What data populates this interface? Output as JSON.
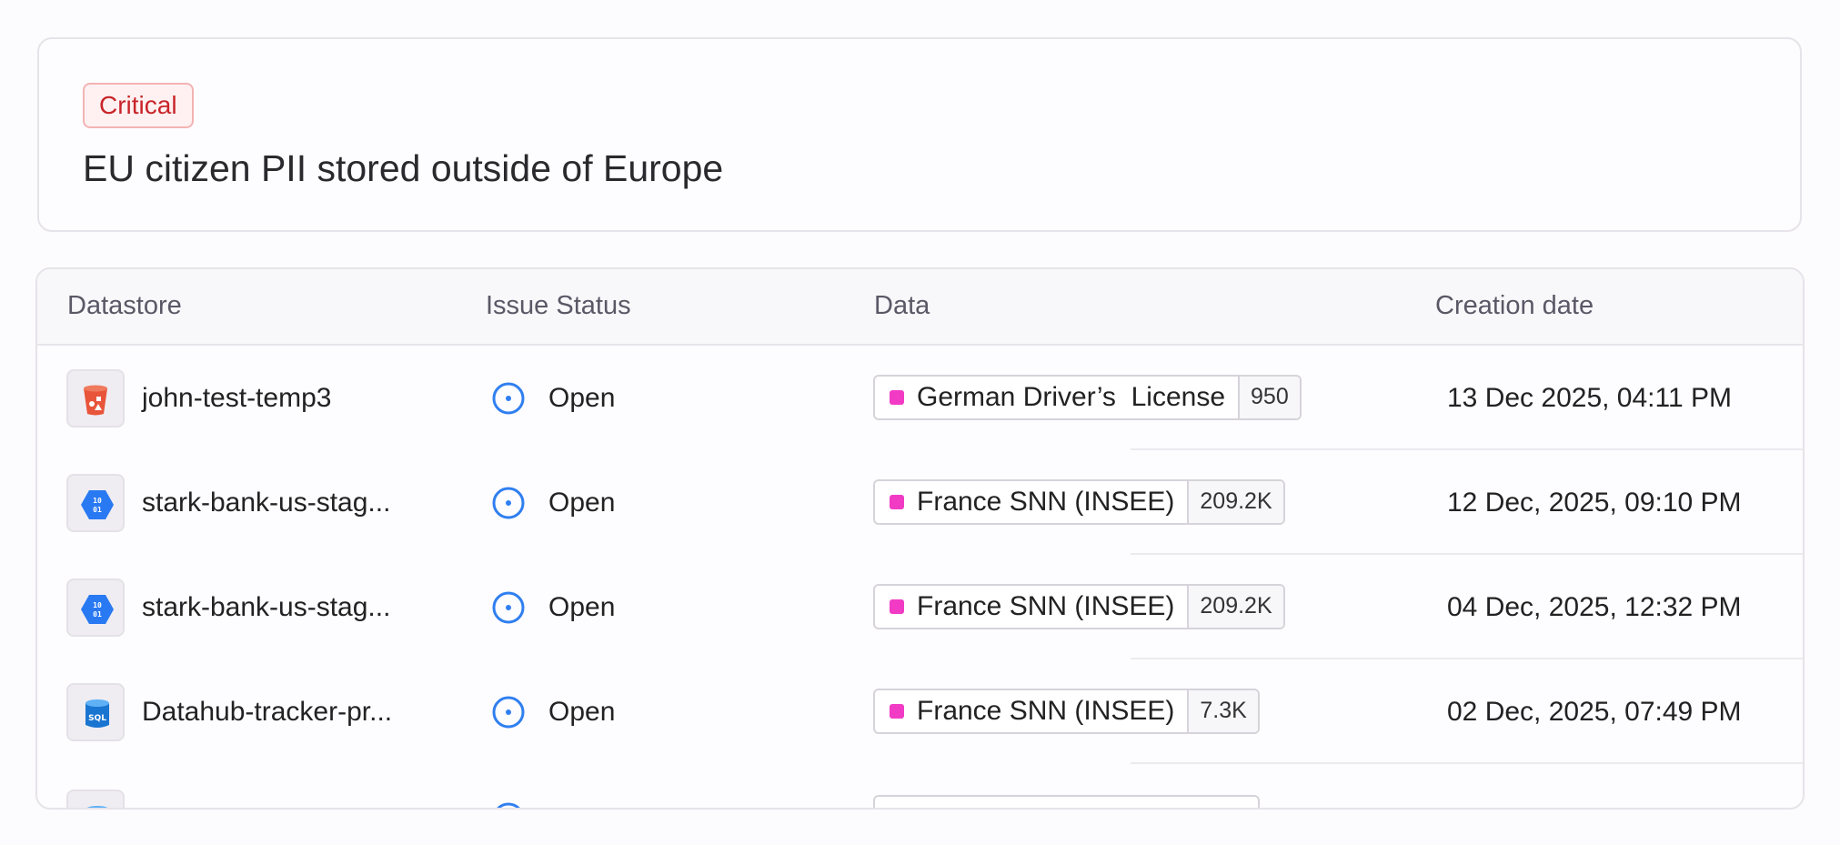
{
  "issue": {
    "severity": "Critical",
    "title": "EU citizen PII stored outside of Europe"
  },
  "table": {
    "headers": {
      "datastore": "Datastore",
      "issue_status": "Issue Status",
      "data": "Data",
      "creation_date": "Creation date"
    },
    "rows": [
      {
        "icon": "s3-bucket-icon",
        "datastore": "john-test-temp3",
        "status": "Open",
        "data_label": "German Driver’s  License",
        "data_count": "950",
        "date": "13 Dec 2025, 04:11 PM"
      },
      {
        "icon": "bigquery-icon",
        "datastore": "stark-bank-us-stag...",
        "status": "Open",
        "data_label": "France SNN (INSEE)",
        "data_count": "209.2K",
        "date": "12 Dec, 2025, 09:10 PM"
      },
      {
        "icon": "bigquery-icon",
        "datastore": "stark-bank-us-stag...",
        "status": "Open",
        "data_label": "France SNN (INSEE)",
        "data_count": "209.2K",
        "date": "04 Dec, 2025, 12:32 PM"
      },
      {
        "icon": "azure-sql-icon",
        "datastore": "Datahub-tracker-pr...",
        "status": "Open",
        "data_label": "France SNN (INSEE)",
        "data_count": "7.3K",
        "date": "02 Dec, 2025, 07:49 PM"
      }
    ]
  },
  "colors": {
    "critical": "#c8242a",
    "status_open": "#2f7ff0",
    "data_marker": "#f23bc4"
  }
}
